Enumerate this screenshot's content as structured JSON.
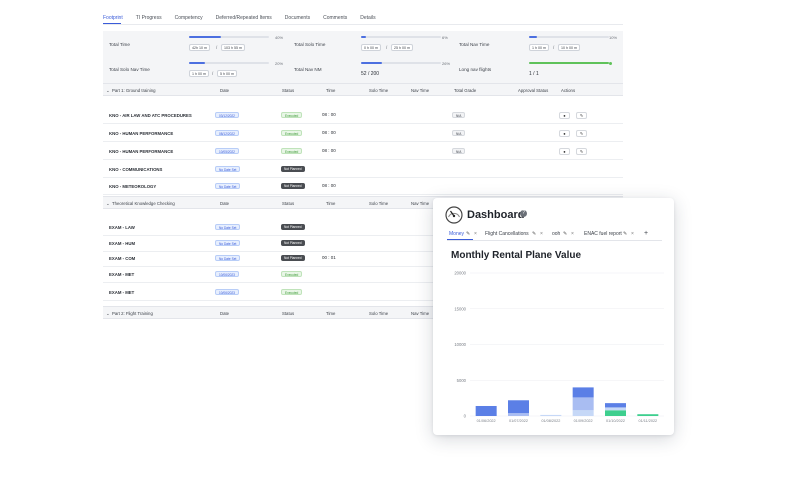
{
  "tabs": [
    {
      "label": "Footprint",
      "active": true
    },
    {
      "label": "TI Progress",
      "active": false
    },
    {
      "label": "Competency",
      "active": false
    },
    {
      "label": "Deferred/Repeated Items",
      "active": false
    },
    {
      "label": "Documents",
      "active": false
    },
    {
      "label": "Comments",
      "active": false
    },
    {
      "label": "Details",
      "active": false
    }
  ],
  "stats": {
    "total_time": {
      "label": "Total Time",
      "pct": "40%",
      "progress": 0.4,
      "a": "42h 10 m",
      "b": "103 h 55 m"
    },
    "total_solo_time": {
      "label": "Total Solo Time",
      "pct": "6%",
      "progress": 0.06,
      "a": "0 h 00 m",
      "b": "25 h 00 m"
    },
    "total_nav_time": {
      "label": "Total Nav Time",
      "pct": "10%",
      "progress": 0.1,
      "a": "1 h 00 m",
      "b": "10 h 00 m"
    },
    "total_solo_nav_time": {
      "label": "Total Solo Nav Time",
      "pct": "20%",
      "progress": 0.2,
      "a": "1 h 00 m",
      "b": "5 h 00 m"
    },
    "total_nav_nm": {
      "label": "Total Nav NM",
      "pct": "26%",
      "progress": 0.26,
      "value": "52  /  200"
    },
    "long_nav_flights": {
      "label": "Long nav flights",
      "progress": 1.0,
      "value": "1  /  1"
    },
    "slash": "/"
  },
  "table": {
    "sections": [
      {
        "title": "Part 1: Ground training",
        "headers": [
          "Date",
          "Status",
          "Time",
          "Solo Time",
          "Nav Time",
          "Total Grade",
          "Approval Status",
          "Actions"
        ],
        "rows": [
          {
            "name": "KNO - AIR LAW AND ATC PROCEDURES",
            "date": "03/12/2022",
            "status": "Executed",
            "time": "08 : 00",
            "grade": "N/A"
          },
          {
            "name": "KNO - HUMAN PERFORMANCE",
            "date": "08/12/2022",
            "status": "Executed",
            "time": "08 : 00",
            "grade": "N/A"
          },
          {
            "name": "KNO - HUMAN PERFORMANCE",
            "date": "10/05/2022",
            "status": "Executed",
            "time": "08 : 00",
            "grade": "N/A"
          },
          {
            "name": "KNO - COMMUNICATIONS",
            "date": "No Date Set",
            "status": "Not Planned",
            "time": "",
            "grade": ""
          },
          {
            "name": "KNO - METEOROLOGY",
            "date": "No Date Set",
            "status": "Not Planned",
            "time": "08 : 00",
            "grade": ""
          }
        ]
      },
      {
        "title": "Theoretical Knowledge Checking",
        "headers": [
          "Date",
          "Status",
          "Time",
          "Solo Time",
          "Nav Time"
        ],
        "rows": [
          {
            "name": "EXAM - LAW",
            "date": "No Date Set",
            "status": "Not Planned",
            "time": ""
          },
          {
            "name": "EXAM - HUM",
            "date": "No Date Set",
            "status": "Not Planned",
            "time": ""
          },
          {
            "name": "EXAM - COM",
            "date": "No Date Set",
            "status": "Not Planned",
            "time": "00 : 01"
          },
          {
            "name": "EXAM - MET",
            "date": "10/06/2023",
            "status": "Executed",
            "time": ""
          },
          {
            "name": "EXAM - MET",
            "date": "10/06/2023",
            "status": "Executed",
            "time": ""
          }
        ]
      },
      {
        "title": "Part 2: Flight Training",
        "headers": [
          "Date",
          "Status",
          "Time",
          "Solo Time",
          "Nav Time"
        ],
        "rows": []
      }
    ]
  },
  "dashboard": {
    "title": "Dashboard",
    "help": "?",
    "tabs": [
      {
        "label": "Money",
        "active": true
      },
      {
        "label": "Flight Cancellations",
        "active": false
      },
      {
        "label": "ooh",
        "active": false
      },
      {
        "label": "ENAC fuel report",
        "active": false
      }
    ],
    "add": "+",
    "x_mark": "×",
    "edit_mark": "✎"
  },
  "chart_data": {
    "type": "bar",
    "title": "Monthly Rental Plane Value",
    "xlabel": "",
    "ylabel": "",
    "ylim": [
      0,
      20000
    ],
    "yticks": [
      0,
      5000,
      10000,
      15000,
      20000
    ],
    "categories": [
      "01/06/2022",
      "01/07/2022",
      "01/08/2022",
      "01/09/2022",
      "01/10/2022",
      "01/11/2022"
    ],
    "stacked": true,
    "series": [
      {
        "color": "#3ecf8e",
        "values": [
          0,
          0,
          0,
          0,
          800,
          250
        ]
      },
      {
        "color": "#c6d8f7",
        "values": [
          0,
          0,
          150,
          800,
          400,
          0
        ]
      },
      {
        "color": "#a9bdf2",
        "values": [
          0,
          400,
          0,
          1800,
          0,
          0
        ]
      },
      {
        "color": "#5b7fe6",
        "values": [
          1400,
          1800,
          0,
          1400,
          600,
          0
        ]
      }
    ],
    "grid": true,
    "legend": "none"
  }
}
